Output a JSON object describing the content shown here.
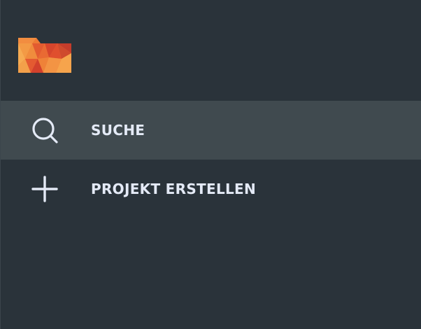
{
  "brand": {
    "logo_icon": "folder-logo-icon",
    "colors": [
      "#f08a3c",
      "#e5552f",
      "#c9402d",
      "#f6a24a"
    ]
  },
  "nav": {
    "items": [
      {
        "label": "SUCHE",
        "icon": "search-icon",
        "active": true
      },
      {
        "label": "PROJEKT ERSTELLEN",
        "icon": "plus-icon",
        "active": false
      }
    ]
  },
  "colors": {
    "sidebar_bg": "#2a333a",
    "active_bg": "#404a4f",
    "text": "#e4eaf6"
  }
}
